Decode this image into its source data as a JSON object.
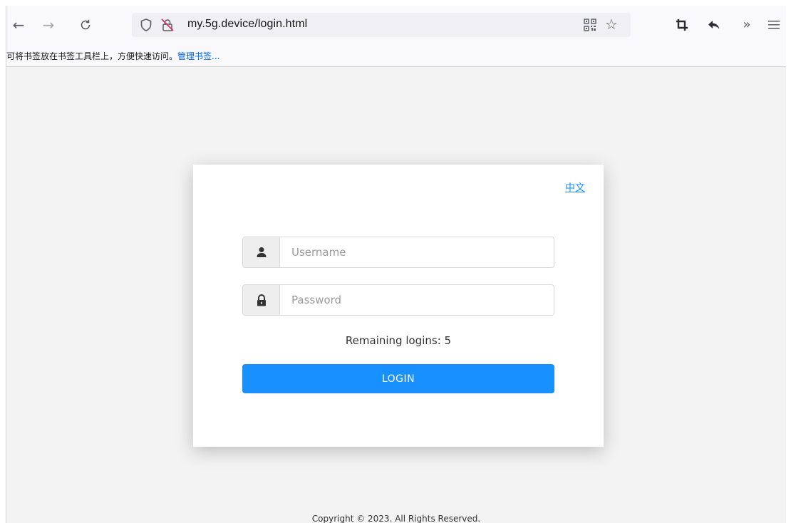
{
  "browser": {
    "url": "my.5g.device/login.html",
    "icons": {
      "back": "back-arrow-icon",
      "forward": "forward-arrow-icon",
      "reload": "reload-icon",
      "tracking": "shield-icon",
      "insecure": "insecure-lock-icon",
      "qr": "qr-code-icon",
      "bookmark": "star-icon",
      "crop": "crop-icon",
      "reply": "reply-icon",
      "overflow": "chevrons-right-icon",
      "menu": "hamburger-menu-icon"
    }
  },
  "bookmarks_bar": {
    "hint": "可将书签放在书签工具栏上，方便快速访问。",
    "manage_link": "管理书签..."
  },
  "login": {
    "language_link": "中文",
    "username_placeholder": "Username",
    "password_placeholder": "Password",
    "remaining_text": "Remaining logins: 5",
    "login_button": "LOGIN"
  },
  "footer": {
    "copyright": "Copyright © 2023. All Rights Reserved."
  },
  "colors": {
    "accent": "#1890ff",
    "page_bg": "#f3f3f3",
    "card_bg": "#ffffff"
  }
}
